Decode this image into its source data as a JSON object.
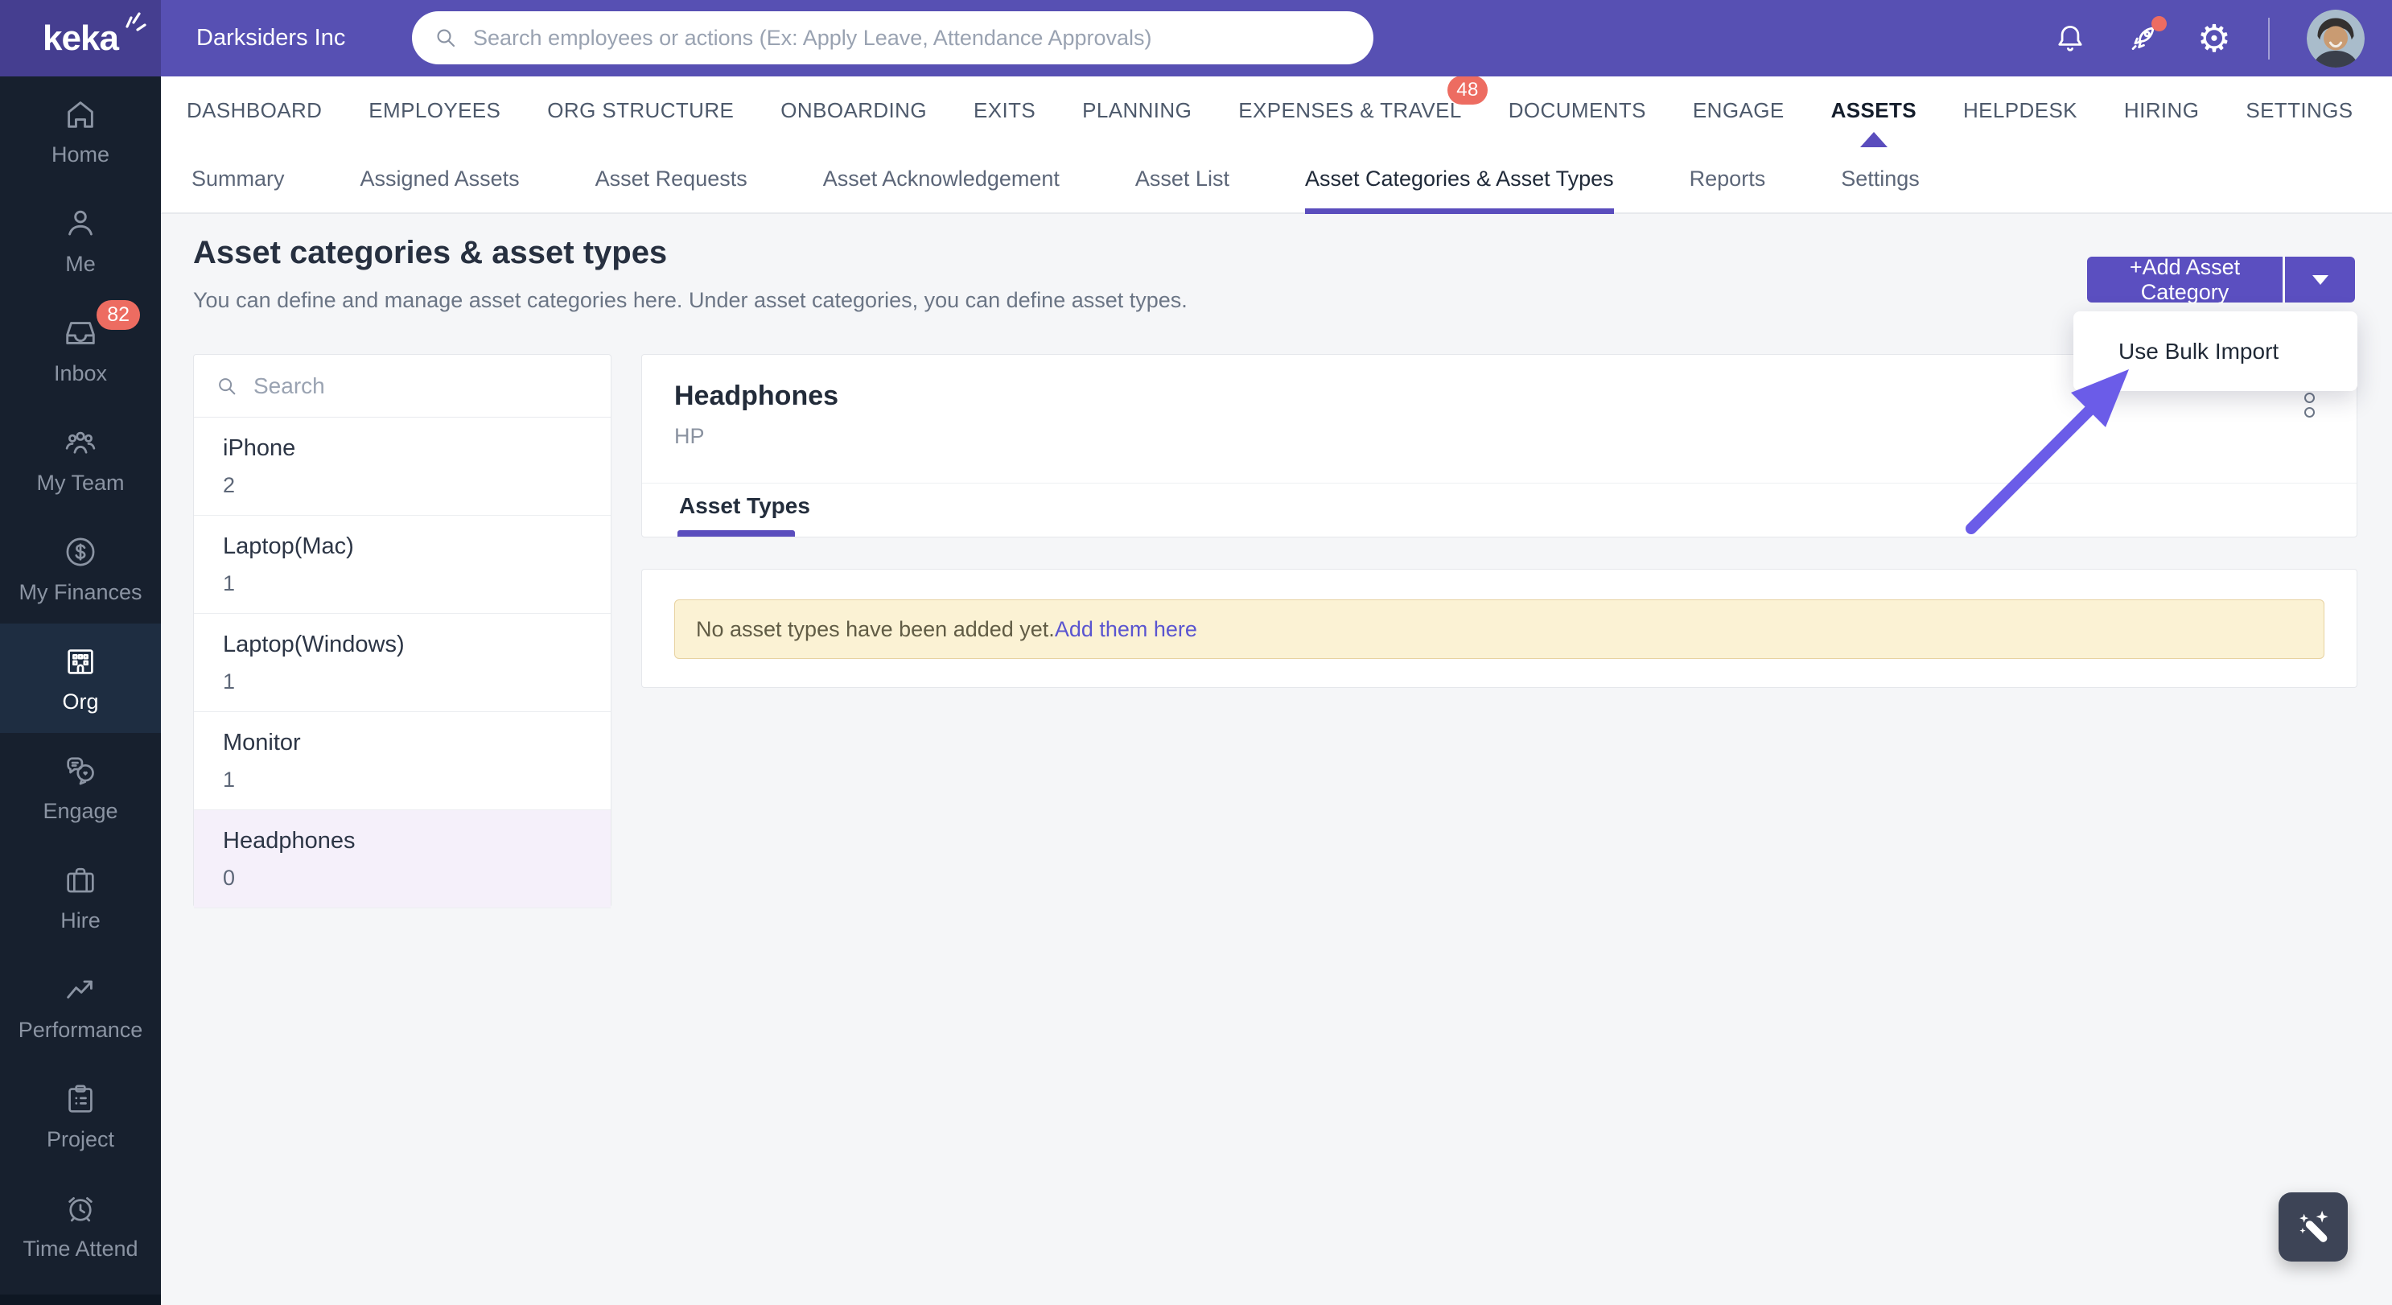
{
  "sidebar": {
    "logo_text": "keka",
    "items": [
      {
        "label": "Home"
      },
      {
        "label": "Me"
      },
      {
        "label": "Inbox",
        "badge": "82"
      },
      {
        "label": "My Team"
      },
      {
        "label": "My Finances"
      },
      {
        "label": "Org",
        "active": true
      },
      {
        "label": "Engage"
      },
      {
        "label": "Hire"
      },
      {
        "label": "Performance"
      },
      {
        "label": "Project"
      },
      {
        "label": "Time Attend"
      }
    ]
  },
  "header": {
    "company": "Darksiders Inc",
    "search_placeholder": "Search employees or actions (Ex: Apply Leave, Attendance Approvals)"
  },
  "main_nav": {
    "items": [
      {
        "label": "DASHBOARD"
      },
      {
        "label": "EMPLOYEES"
      },
      {
        "label": "ORG STRUCTURE"
      },
      {
        "label": "ONBOARDING"
      },
      {
        "label": "EXITS"
      },
      {
        "label": "PLANNING"
      },
      {
        "label": "EXPENSES & TRAVEL",
        "badge": "48"
      },
      {
        "label": "DOCUMENTS"
      },
      {
        "label": "ENGAGE"
      },
      {
        "label": "ASSETS",
        "active": true
      },
      {
        "label": "HELPDESK"
      },
      {
        "label": "HIRING"
      },
      {
        "label": "SETTINGS"
      }
    ]
  },
  "sub_nav": {
    "items": [
      {
        "label": "Summary"
      },
      {
        "label": "Assigned Assets"
      },
      {
        "label": "Asset Requests"
      },
      {
        "label": "Asset Acknowledgement"
      },
      {
        "label": "Asset List"
      },
      {
        "label": "Asset Categories & Asset Types",
        "active": true
      },
      {
        "label": "Reports"
      },
      {
        "label": "Settings"
      }
    ]
  },
  "page": {
    "title": "Asset categories & asset types",
    "description": "You can define and manage asset categories here. Under asset categories, you can define asset types.",
    "add_button": "+Add Asset Category",
    "menu_item": "Use Bulk Import"
  },
  "categories": {
    "search_placeholder": "Search",
    "items": [
      {
        "name": "iPhone",
        "count": "2"
      },
      {
        "name": "Laptop(Mac)",
        "count": "1"
      },
      {
        "name": "Laptop(Windows)",
        "count": "1"
      },
      {
        "name": "Monitor",
        "count": "1"
      },
      {
        "name": "Headphones",
        "count": "0",
        "selected": true
      }
    ]
  },
  "detail": {
    "title": "Headphones",
    "subtitle": "HP",
    "tab": "Asset Types",
    "empty_message": "No asset types have been added yet.",
    "empty_link": "Add them here"
  },
  "colors": {
    "accent_purple": "#5b4fc0",
    "header_purple": "#5750b3",
    "sidebar_navy": "#17202e",
    "badge_red": "#ed6c61",
    "arrow_purple": "#6b5ce8",
    "banner_bg": "#fbf2d4"
  }
}
